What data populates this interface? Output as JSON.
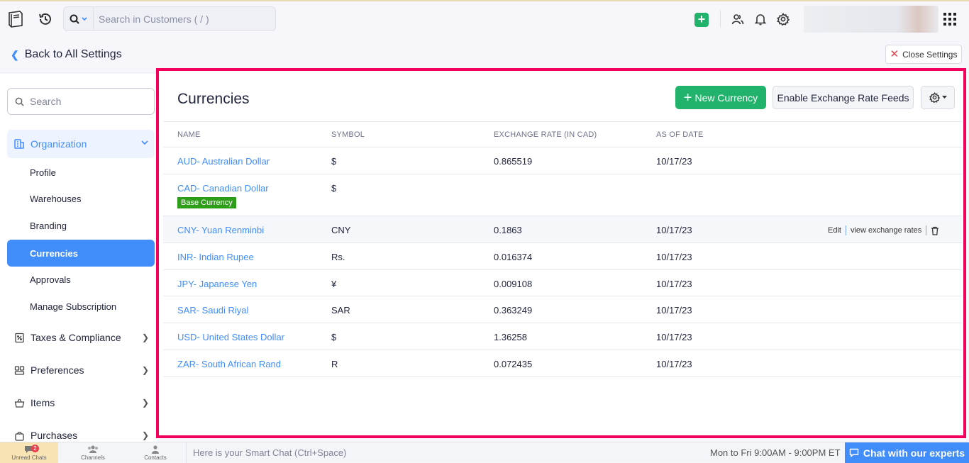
{
  "header": {
    "search_placeholder": "Search in Customers ( / )",
    "icons": [
      "book-logo-icon",
      "history-icon",
      "search-icon",
      "add-icon",
      "users-icon",
      "bell-icon",
      "gear-icon",
      "apps-grid-icon"
    ],
    "accent_color": "#21b36b"
  },
  "subbar": {
    "back_label": "Back to All Settings",
    "close_label": "Close Settings"
  },
  "sidebar": {
    "search_placeholder": "Search",
    "organization_label": "Organization",
    "sub_items": [
      "Profile",
      "Warehouses",
      "Branding",
      "Currencies",
      "Approvals",
      "Manage Subscription"
    ],
    "active_item": "Currencies",
    "groups": [
      "Taxes & Compliance",
      "Preferences",
      "Items",
      "Purchases"
    ]
  },
  "main": {
    "title": "Currencies",
    "new_button": "New Currency",
    "feed_button": "Enable Exchange Rate Feeds",
    "columns": [
      "NAME",
      "SYMBOL",
      "EXCHANGE RATE (IN CAD)",
      "AS OF DATE"
    ],
    "base_badge": "Base Currency",
    "rows": [
      {
        "name": "AUD- Australian Dollar",
        "symbol": "$",
        "rate": "0.865519",
        "date": "10/17/23"
      },
      {
        "name": "CAD- Canadian Dollar",
        "symbol": "$",
        "rate": "",
        "date": ""
      },
      {
        "name": "CNY- Yuan Renminbi",
        "symbol": "CNY",
        "rate": "0.1863",
        "date": "10/17/23"
      },
      {
        "name": "INR- Indian Rupee",
        "symbol": "Rs.",
        "rate": "0.016374",
        "date": "10/17/23"
      },
      {
        "name": "JPY- Japanese Yen",
        "symbol": "¥",
        "rate": "0.009108",
        "date": "10/17/23"
      },
      {
        "name": "SAR- Saudi Riyal",
        "symbol": "SAR",
        "rate": "0.363249",
        "date": "10/17/23"
      },
      {
        "name": "USD- United States Dollar",
        "symbol": "$",
        "rate": "1.36258",
        "date": "10/17/23"
      },
      {
        "name": "ZAR- South African Rand",
        "symbol": "R",
        "rate": "0.072435",
        "date": "10/17/23"
      }
    ],
    "row_actions": {
      "edit": "Edit",
      "view": "view exchange rates"
    }
  },
  "footer": {
    "tabs": [
      "Unread Chats",
      "Channels",
      "Contacts"
    ],
    "unread_count": "2",
    "smart_chat": "Here is your Smart Chat (Ctrl+Space)",
    "hours": "Mon to Fri 9:00AM - 9:00PM ET",
    "chat_button": "Chat with our experts"
  }
}
